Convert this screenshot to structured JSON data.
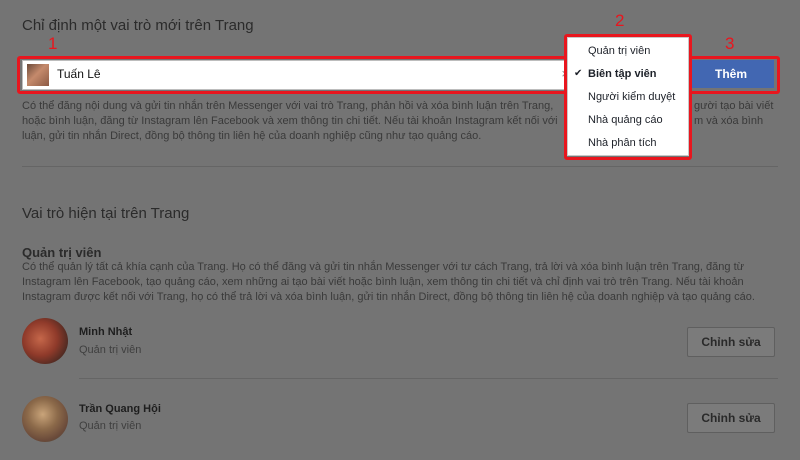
{
  "assign": {
    "title": "Chỉ định một vai trò mới trên Trang",
    "input_value": "Tuấn Lê",
    "clear_symbol": "×",
    "add_button": "Thêm",
    "description_lines": [
      "Có thể đăng nội dung và gửi tin nhắn trên Messenger với vai trò Trang, phản hồi và xóa bình luận trên Trang, ",
      "hoặc bình luận, đăng từ Instagram lên Facebook và xem thông tin chi tiết. Nếu tài khoản Instagram kết nối với ",
      "luận, gửi tin nhắn Direct, đồng bộ thông tin liên hệ của doanh nghiệp cũng như tạo quảng cáo."
    ],
    "description_right": [
      "gười tạo bài viết",
      "m và xóa bình"
    ]
  },
  "dropdown": {
    "items": [
      {
        "label": "Quản trị viên",
        "selected": false
      },
      {
        "label": "Biên tập viên",
        "selected": true
      },
      {
        "label": "Người kiểm duyệt",
        "selected": false
      },
      {
        "label": "Nhà quảng cáo",
        "selected": false
      },
      {
        "label": "Nhà phân tích",
        "selected": false
      }
    ],
    "check_symbol": "✔"
  },
  "annotations": {
    "one": "1",
    "two": "2",
    "three": "3"
  },
  "current_roles": {
    "title": "Vai trò hiện tại trên Trang",
    "admin_title": "Quản trị viên",
    "admin_description": [
      "Có thể quản lý tất cả khía cạnh của Trang. Họ có thể đăng và gửi tin nhắn Messenger với tư cách Trang, trả lời và xóa bình luận trên Trang, đăng từ",
      "Instagram lên Facebook, tạo quảng cáo, xem những ai tạo bài viết hoặc bình luận, xem thông tin chi tiết và chỉ định vai trò trên Trang. Nếu tài khoản",
      "Instagram được kết nối với Trang, họ có thể trả lời và xóa bình luận, gửi tin nhắn Direct, đồng bộ thông tin liên hệ của doanh nghiệp và tạo quảng cáo."
    ],
    "members": [
      {
        "name": "Minh Nhật",
        "role": "Quản trị viên",
        "edit_label": "Chỉnh sửa"
      },
      {
        "name": "Trần Quang Hội",
        "role": "Quản trị viên",
        "edit_label": "Chỉnh sửa"
      }
    ]
  },
  "colors": {
    "annotation_red": "#e8161e",
    "primary_button": "#4267b2",
    "overlay": "#747474"
  }
}
